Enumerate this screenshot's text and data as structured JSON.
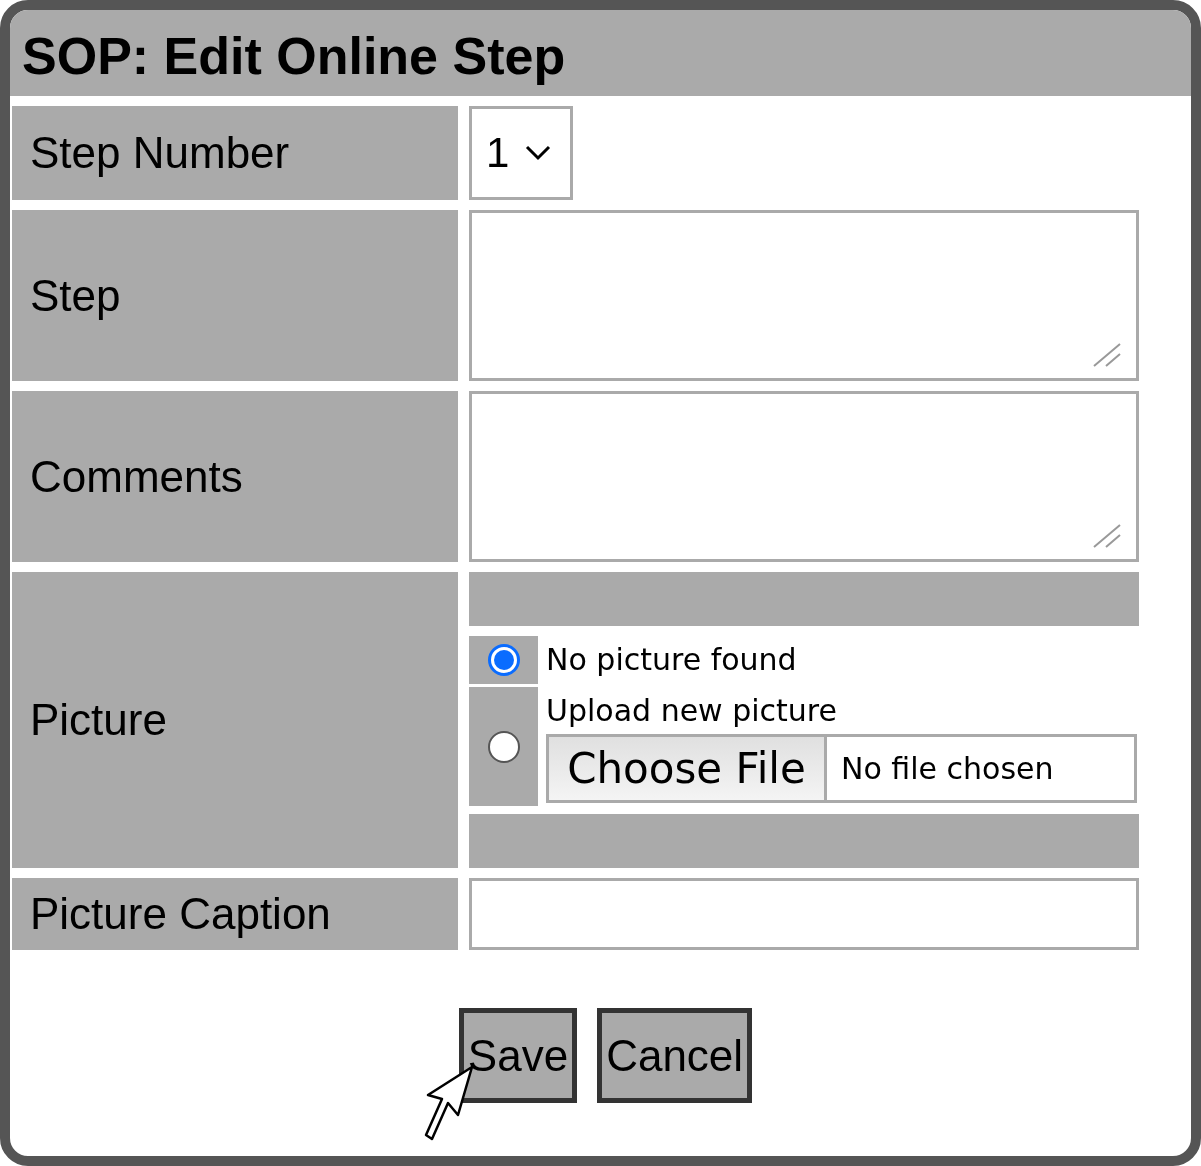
{
  "window": {
    "title": "SOP: Edit Online Step"
  },
  "fields": [
    {
      "kind": "select",
      "label": "Step Number",
      "value": "1"
    },
    {
      "kind": "textarea",
      "label": "Step"
    },
    {
      "kind": "textarea",
      "label": "Comments"
    },
    {
      "kind": "picture",
      "label": "Picture",
      "options": [
        {
          "label": "No picture found",
          "selected": true
        },
        {
          "label": "Upload new picture",
          "selected": false,
          "file_button": "Choose File",
          "file_status": "No file chosen"
        }
      ]
    },
    {
      "kind": "text",
      "label": "Picture Caption"
    }
  ],
  "buttons": [
    "Save",
    "Cancel"
  ]
}
